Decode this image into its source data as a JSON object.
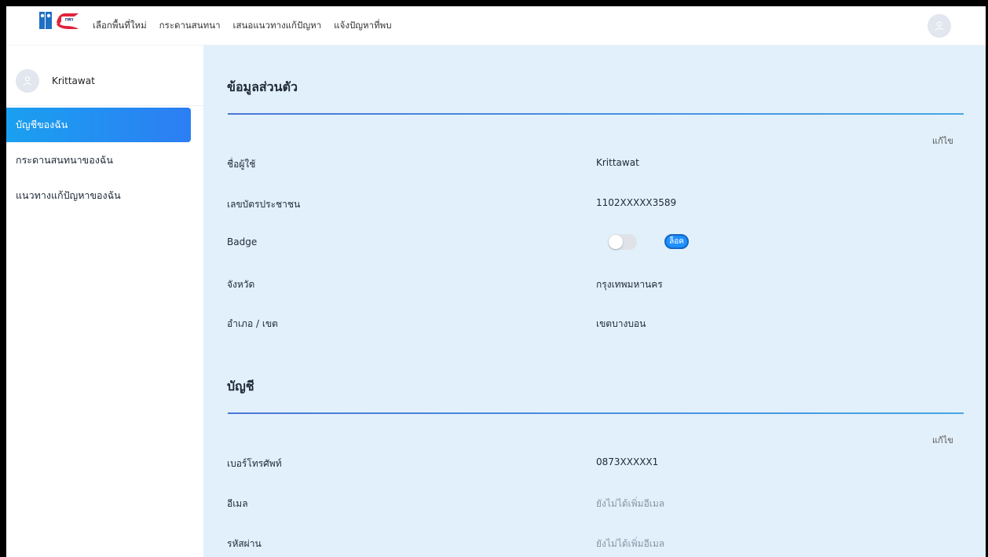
{
  "nav": {
    "links": [
      "เลือกพื้นที่ใหม่",
      "กระดานสนทนา",
      "เสนอแนวทางแก้ปัญหา",
      "แจ้งปัญหาที่พบ"
    ],
    "logo_text": "กพร"
  },
  "sidebar": {
    "profile_name": "Krittawat",
    "items": [
      {
        "label": "บัญชีของฉัน",
        "active": true
      },
      {
        "label": "กระดานสนทนาของฉัน",
        "active": false
      },
      {
        "label": "แนวทางแก้ปัญหาของฉัน",
        "active": false
      }
    ]
  },
  "personal": {
    "title": "ข้อมูลส่วนตัว",
    "edit_label": "แก้ไข",
    "rows": [
      {
        "label": "ชื่อผู้ใช้",
        "value": "Krittawat"
      },
      {
        "label": "เลขบัตรประชาชน",
        "value": "1102XXXXX3589"
      },
      {
        "label": "Badge",
        "toggle_on": false,
        "badge": "ล็อค"
      },
      {
        "label": "จังหวัด",
        "value": "กรุงเทพมหานคร"
      },
      {
        "label": "อำเภอ / เขต",
        "value": "เขตบางบอน"
      }
    ]
  },
  "account": {
    "title": "บัญชี",
    "edit_label": "แก้ไข",
    "rows": [
      {
        "label": "เบอร์โทรศัพท์",
        "value": "0873XXXXX1"
      },
      {
        "label": "อีเมล",
        "value": "ยังไม่ได้เพิ่มอีเมล"
      },
      {
        "label": "รหัสผ่าน",
        "value": "ยังไม่ได้เพิ่มอีเมล"
      }
    ]
  },
  "colors": {
    "accent": "#1e90ff",
    "sidebar_active_start": "#1aa0f0",
    "sidebar_active_end": "#2c7ef3",
    "main_bg": "#e2f0fb",
    "divider": "#4a78d8"
  }
}
